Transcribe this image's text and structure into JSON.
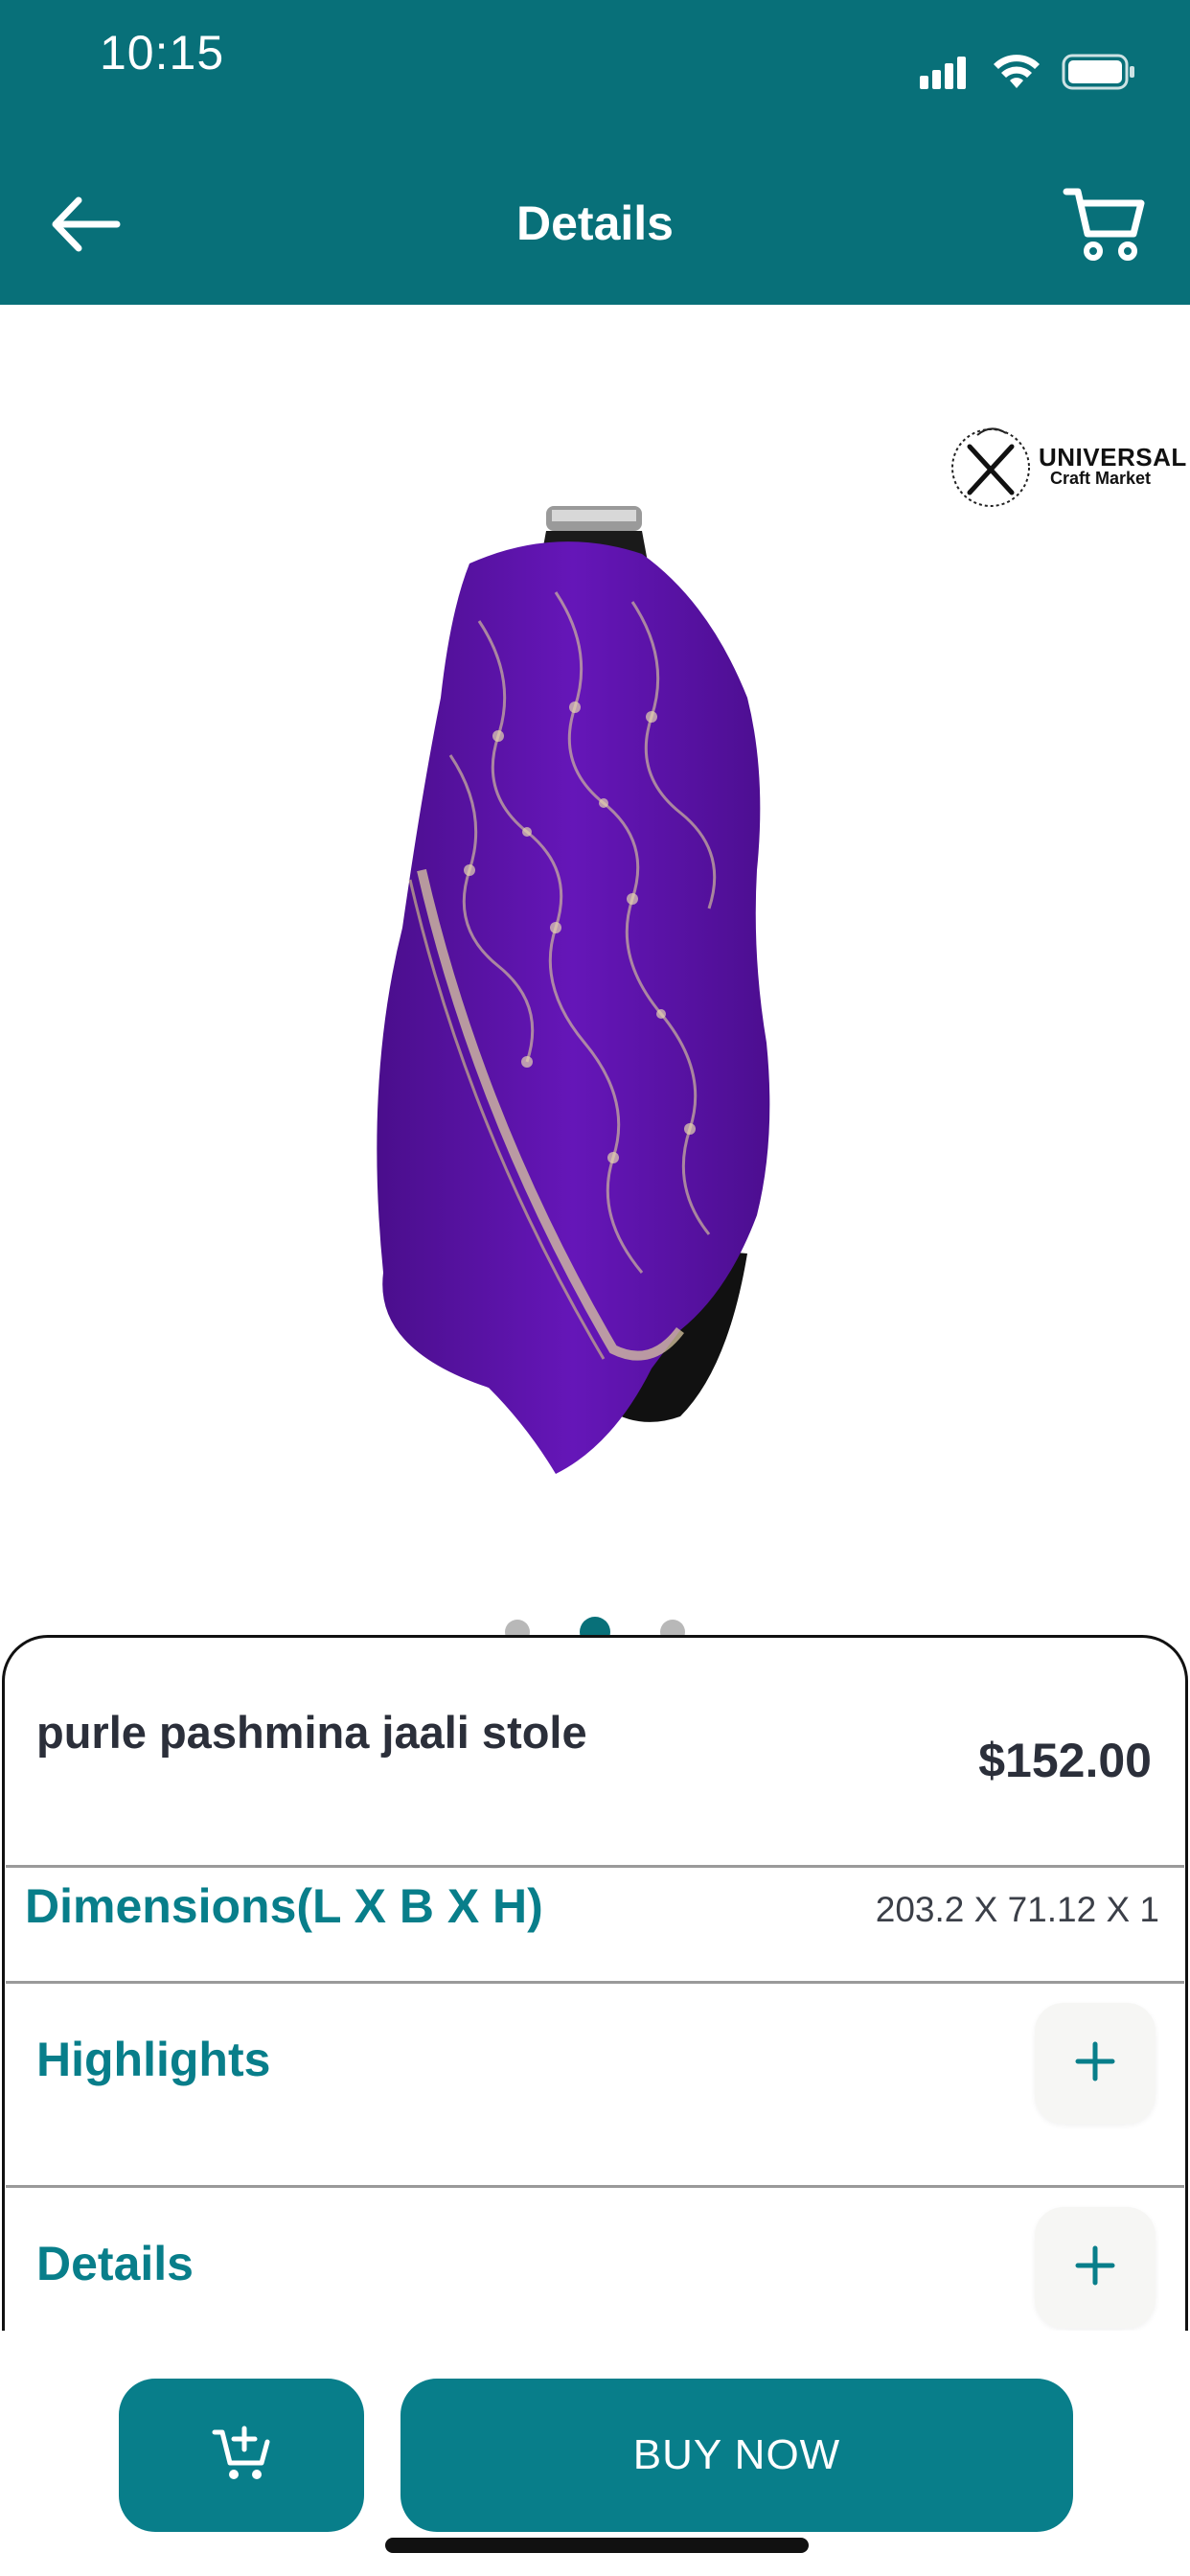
{
  "status_bar": {
    "time": "10:15"
  },
  "header": {
    "title": "Details"
  },
  "brand": {
    "line1": "UNIVERSAL",
    "line2": "Craft Market"
  },
  "carousel": {
    "count": 3,
    "active_index": 1
  },
  "product": {
    "name": "purle pashmina jaali stole",
    "price": "$152.00",
    "dimensions_label": "Dimensions(L X B X H)",
    "dimensions_value": "203.2 X 71.12  X 1"
  },
  "sections": {
    "highlights": "Highlights",
    "details": "Details"
  },
  "actions": {
    "buy_now": "BUY NOW"
  },
  "colors": {
    "primary": "#087079",
    "accent": "#087e8a",
    "product_purple": "#5b12a6",
    "text_dark": "#2b2f3a"
  }
}
